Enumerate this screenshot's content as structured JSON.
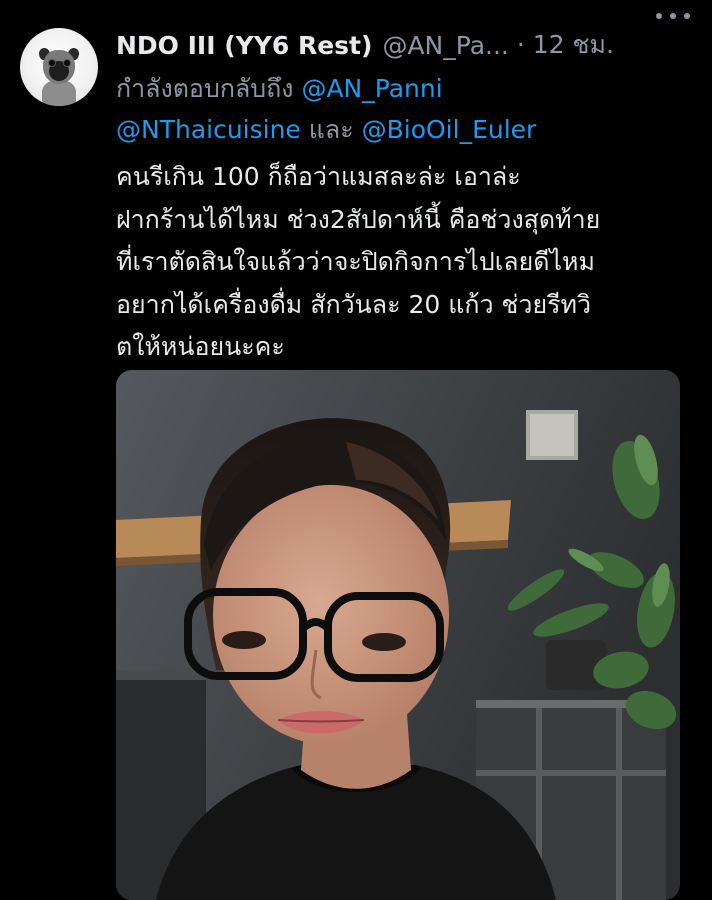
{
  "tweet": {
    "display_name": "NDO III (YY6 Rest)",
    "handle": "@AN_Pa...",
    "time": "· 12 ชม.",
    "reply_prefix": "กำลังตอบกลับถึง",
    "mentions": [
      "@AN_Panni",
      "@NThaicuisine",
      "@BioOil_Euler"
    ],
    "reply_connector": "และ",
    "text_lines": [
      "คนรีเกิน 100 ก็ถือว่าแมสละล่ะ  เอาล่ะ",
      "ฝากร้านได้ไหม  ช่วง2สัปดาห์นี้ คือช่วงสุดท้าย",
      "ที่เราตัดสินใจแล้วว่าจะปิดกิจการไปเลยดีไหม",
      "อยากได้เครื่องดื่ม สักวันละ 20 แก้ว ช่วยรีทวิ",
      "ตให้หน่อยนะคะ"
    ]
  },
  "icons": {
    "more": "more-horizontal-icon",
    "avatar": "pug-avatar"
  },
  "colors": {
    "background": "#000000",
    "primary_text": "#e7e9ea",
    "secondary_text": "#8b98a5",
    "link": "#1d9bf0"
  }
}
